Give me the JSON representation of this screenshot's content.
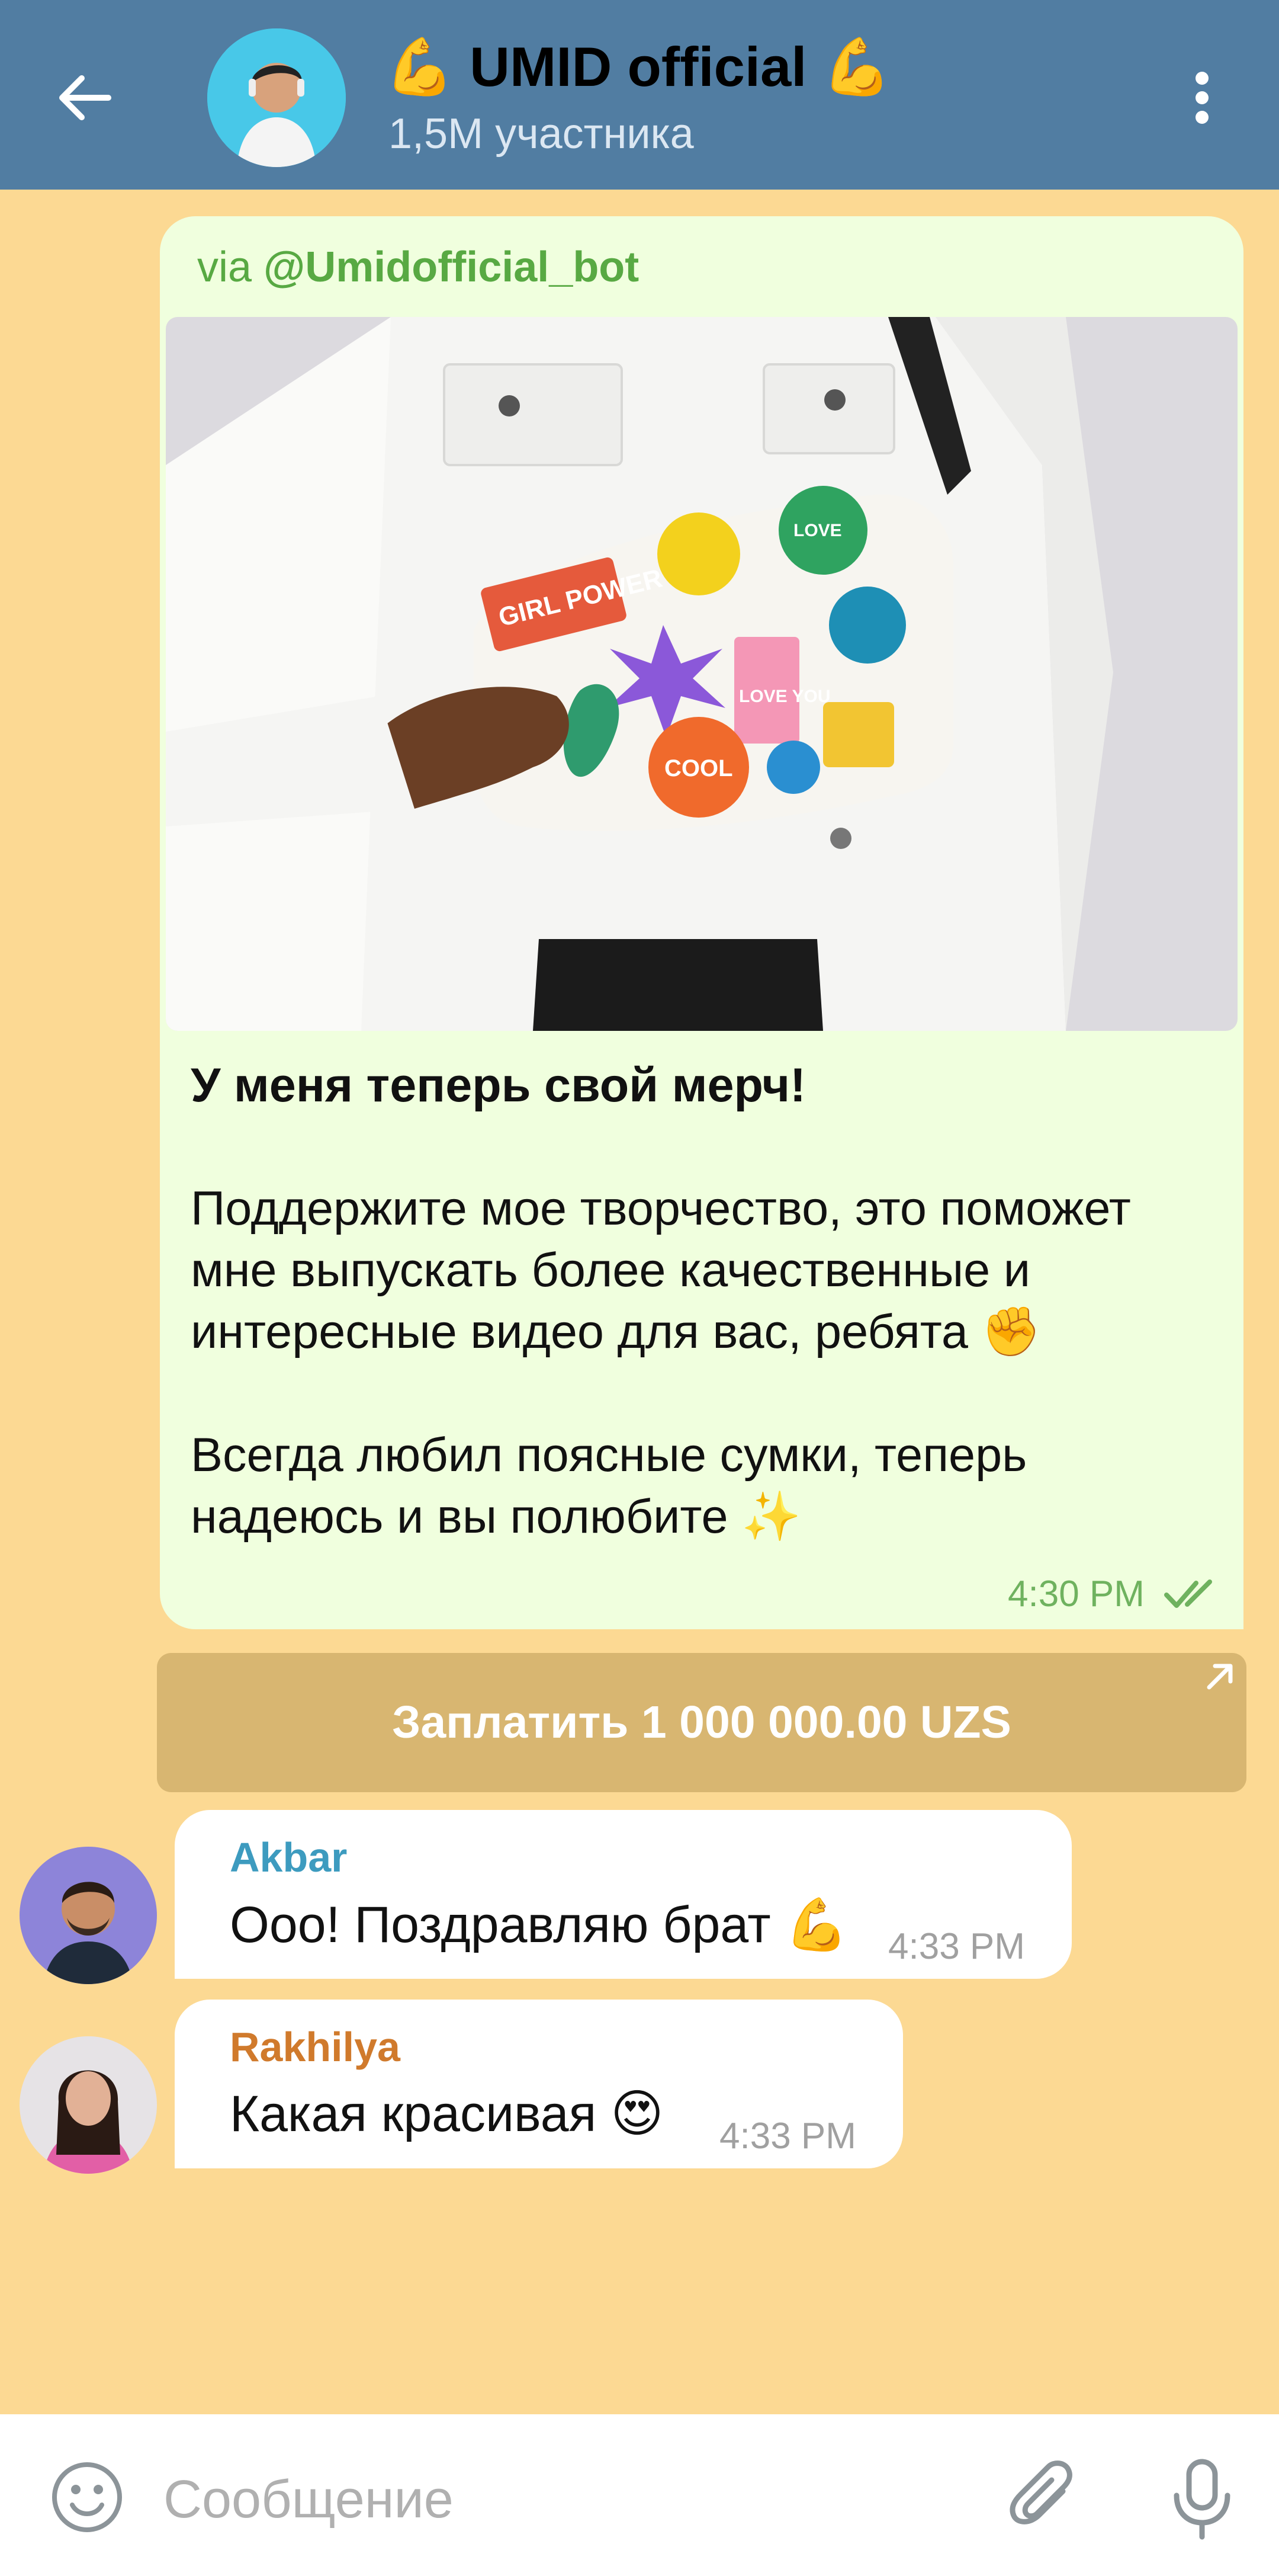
{
  "header": {
    "title": "💪 UMID official 💪",
    "subtitle": "1,5M участника"
  },
  "post": {
    "via_prefix": "via ",
    "via_bot": "@Umidofficial_bot",
    "paragraphs": [
      "У меня теперь свой мерч!",
      "Поддержите мое творчество, это поможет мне выпускать более качественные и интересные видео для вас, ребята ✊",
      "Всегда любил поясные сумки, теперь надеюсь и вы полюбите ✨"
    ],
    "time": "4:30 PM",
    "pay_button": "Заплатить 1 000 000.00 UZS",
    "photo_stickers": [
      "GIRL POWER",
      "LOVE YOU",
      "COOL",
      "LOVE"
    ]
  },
  "messages": [
    {
      "sender": "Akbar",
      "text": "Ооо! Поздравляю брат 💪",
      "time": "4:33 PM",
      "color": "#3d9bbf"
    },
    {
      "sender": "Rakhilya",
      "text": "Какая красивая 😍",
      "time": "4:33 PM",
      "color": "#d07a2c"
    }
  ],
  "input": {
    "placeholder": "Сообщение"
  },
  "colors": {
    "header": "#517DA2",
    "background": "#FCD993",
    "bubble_out": "#F0FFDE",
    "pay_button": "#D8B671"
  }
}
